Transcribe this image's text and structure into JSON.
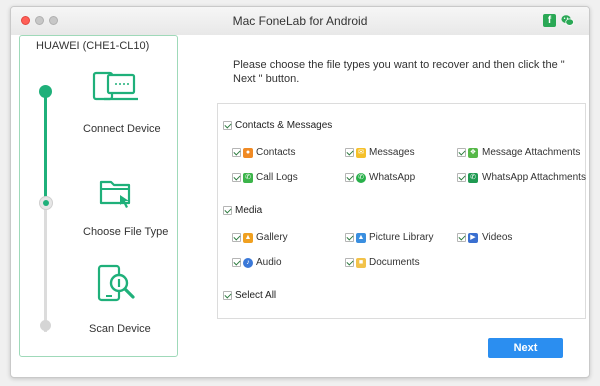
{
  "window": {
    "title": "Mac FoneLab for Android"
  },
  "titlebar_icons": [
    {
      "name": "facebook-icon",
      "glyph": "f",
      "color": "#2aa855"
    },
    {
      "name": "wechat-icon",
      "color": "#2aa855"
    }
  ],
  "sidebar": {
    "device_name": "HUAWEI (CHE1-CL10)",
    "steps": [
      {
        "label": "Connect Device",
        "icon": "connect-device-icon",
        "status": "done"
      },
      {
        "label": "Choose File Type",
        "icon": "choose-file-type-icon",
        "status": "current"
      },
      {
        "label": "Scan Device",
        "icon": "scan-device-icon",
        "status": "pending"
      }
    ]
  },
  "instruction": "Please choose the file types you want to recover and then click the \" Next \" button.",
  "categories": [
    {
      "label": "Contacts & Messages",
      "checked": true,
      "items": [
        {
          "label": "Contacts",
          "icon": "contacts-icon",
          "color": "#f08a24",
          "checked": true
        },
        {
          "label": "Messages",
          "icon": "messages-icon",
          "color": "#f5c02a",
          "checked": true
        },
        {
          "label": "Message Attachments",
          "icon": "message-attachments-icon",
          "color": "#56b848",
          "checked": true
        },
        {
          "label": "Call Logs",
          "icon": "call-logs-icon",
          "color": "#3cb44a",
          "checked": true
        },
        {
          "label": "WhatsApp",
          "icon": "whatsapp-icon",
          "color": "#28b04a",
          "checked": true
        },
        {
          "label": "WhatsApp Attachments",
          "icon": "whatsapp-attachments-icon",
          "color": "#1f9a52",
          "checked": true
        }
      ]
    },
    {
      "label": "Media",
      "checked": true,
      "items": [
        {
          "label": "Gallery",
          "icon": "gallery-icon",
          "color": "#f0a020",
          "checked": true
        },
        {
          "label": "Picture Library",
          "icon": "picture-library-icon",
          "color": "#3a8fe0",
          "checked": true
        },
        {
          "label": "Videos",
          "icon": "videos-icon",
          "color": "#3a6fd0",
          "checked": true
        },
        {
          "label": "Audio",
          "icon": "audio-icon",
          "color": "#3a78d8",
          "checked": true
        },
        {
          "label": "Documents",
          "icon": "documents-icon",
          "color": "#f2c24a",
          "checked": true
        }
      ]
    }
  ],
  "select_all": {
    "label": "Select All",
    "checked": true
  },
  "next_button": "Next",
  "colors": {
    "accent_green": "#1fb07a",
    "button_blue": "#2b8ef0",
    "sidebar_border": "#9fd9b9"
  }
}
